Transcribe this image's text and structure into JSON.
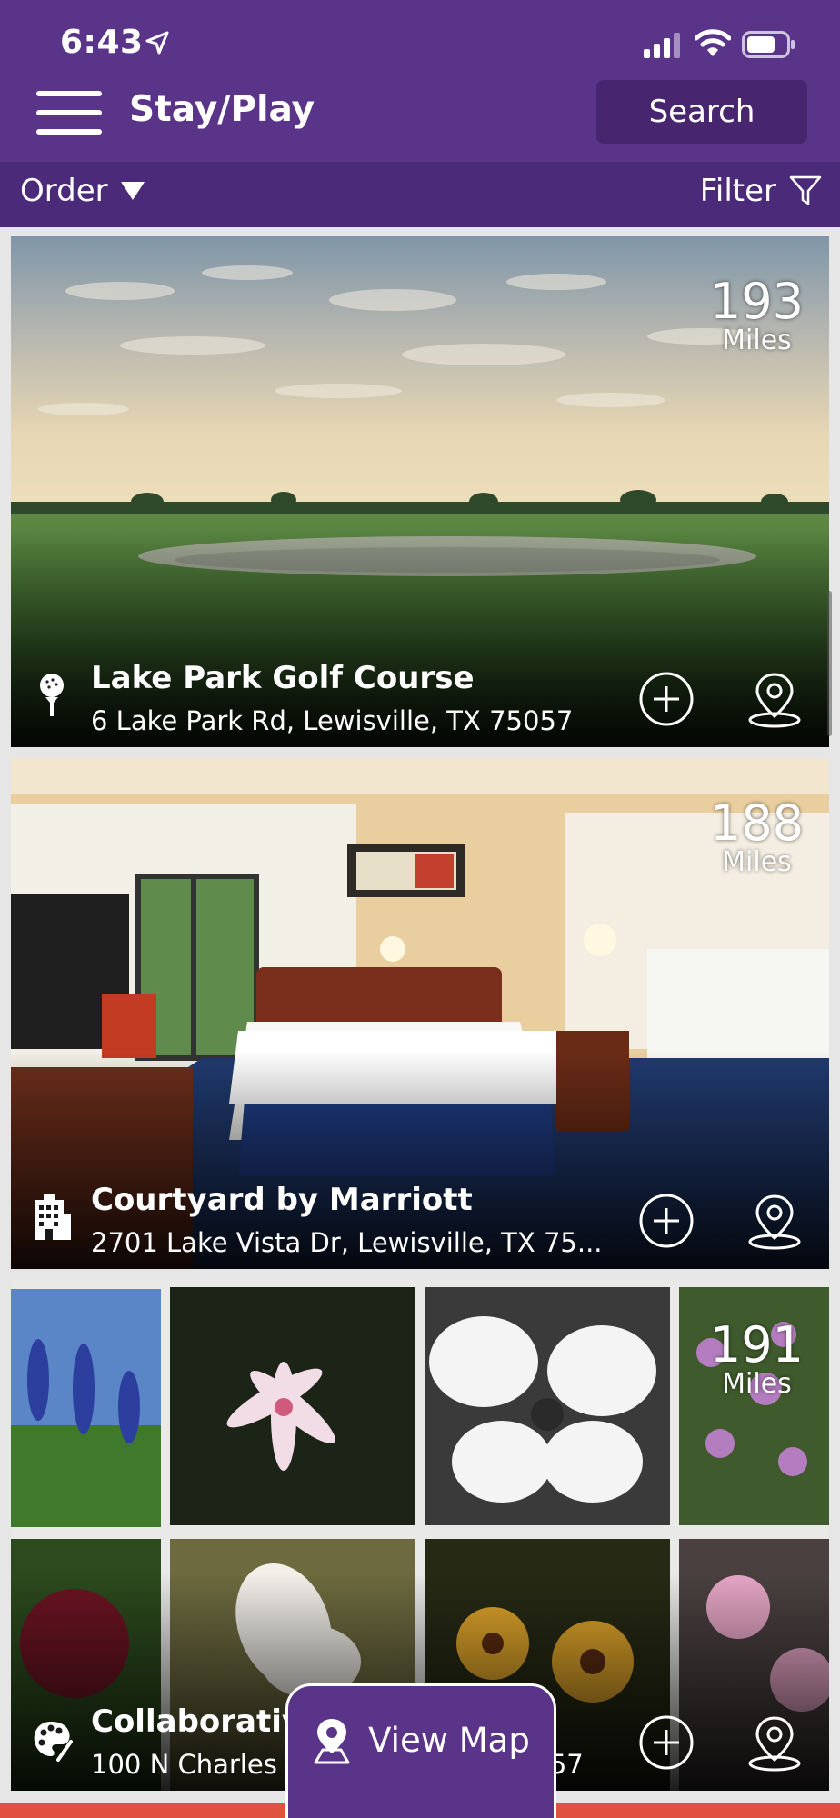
{
  "status": {
    "time": "6:43"
  },
  "header": {
    "title": "Stay/Play",
    "search_label": "Search"
  },
  "controls": {
    "order_label": "Order",
    "filter_label": "Filter"
  },
  "cards": [
    {
      "name": "Lake Park Golf Course",
      "address": "6 Lake Park Rd, Lewisville, TX 75057",
      "distance": "193",
      "unit": "Miles",
      "category_icon": "golf-icon"
    },
    {
      "name": "Courtyard by Marriott",
      "address": "2701 Lake Vista Dr, Lewisville, TX 75...",
      "distance": "188",
      "unit": "Miles",
      "category_icon": "hotel-icon"
    },
    {
      "name": "Collaborative",
      "address": "100 N Charles",
      "address_tail": "57",
      "distance": "191",
      "unit": "Miles",
      "category_icon": "art-palette-icon"
    }
  ],
  "view_map_label": "View Map",
  "colors": {
    "brand_purple": "#5a3489",
    "control_bar": "#4b2a79",
    "search_button": "#47256f"
  }
}
